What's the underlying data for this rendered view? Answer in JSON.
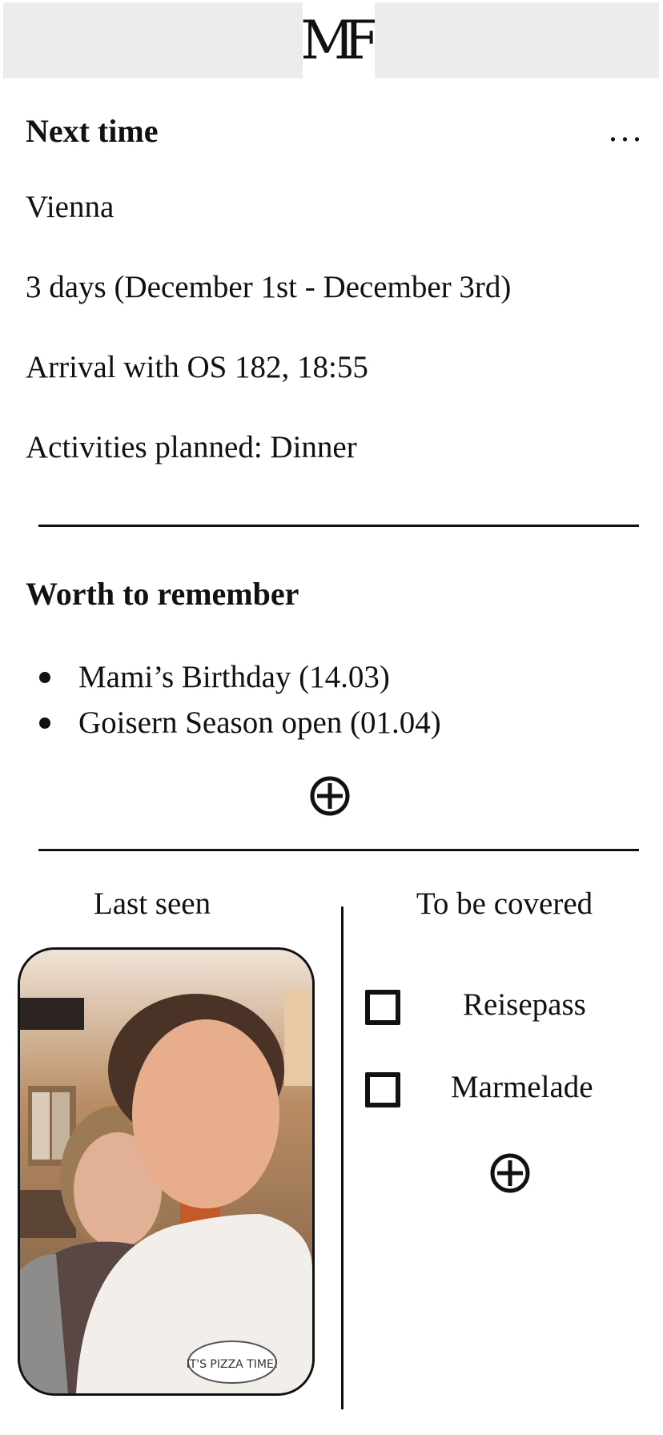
{
  "header": {
    "logo_text": "MF"
  },
  "next_time": {
    "title": "Next time",
    "more_label": "...",
    "location": "Vienna",
    "duration": "3 days (December 1st - December 3rd)",
    "arrival": "Arrival with OS 182, 18:55",
    "activities": "Activities planned: Dinner"
  },
  "remember": {
    "title": "Worth to remember",
    "items": [
      {
        "label": "Mami’s Birthday (14.03)"
      },
      {
        "label": "Goisern Season open (01.04)"
      }
    ],
    "add_icon": "plus-circle-icon"
  },
  "last_seen": {
    "title": "Last seen",
    "photo_text": "IT'S PIZZA TIME!"
  },
  "to_be_covered": {
    "title": "To be covered",
    "items": [
      {
        "label": "Reisepass",
        "checked": false
      },
      {
        "label": "Marmelade",
        "checked": false
      }
    ],
    "add_icon": "plus-circle-icon"
  }
}
